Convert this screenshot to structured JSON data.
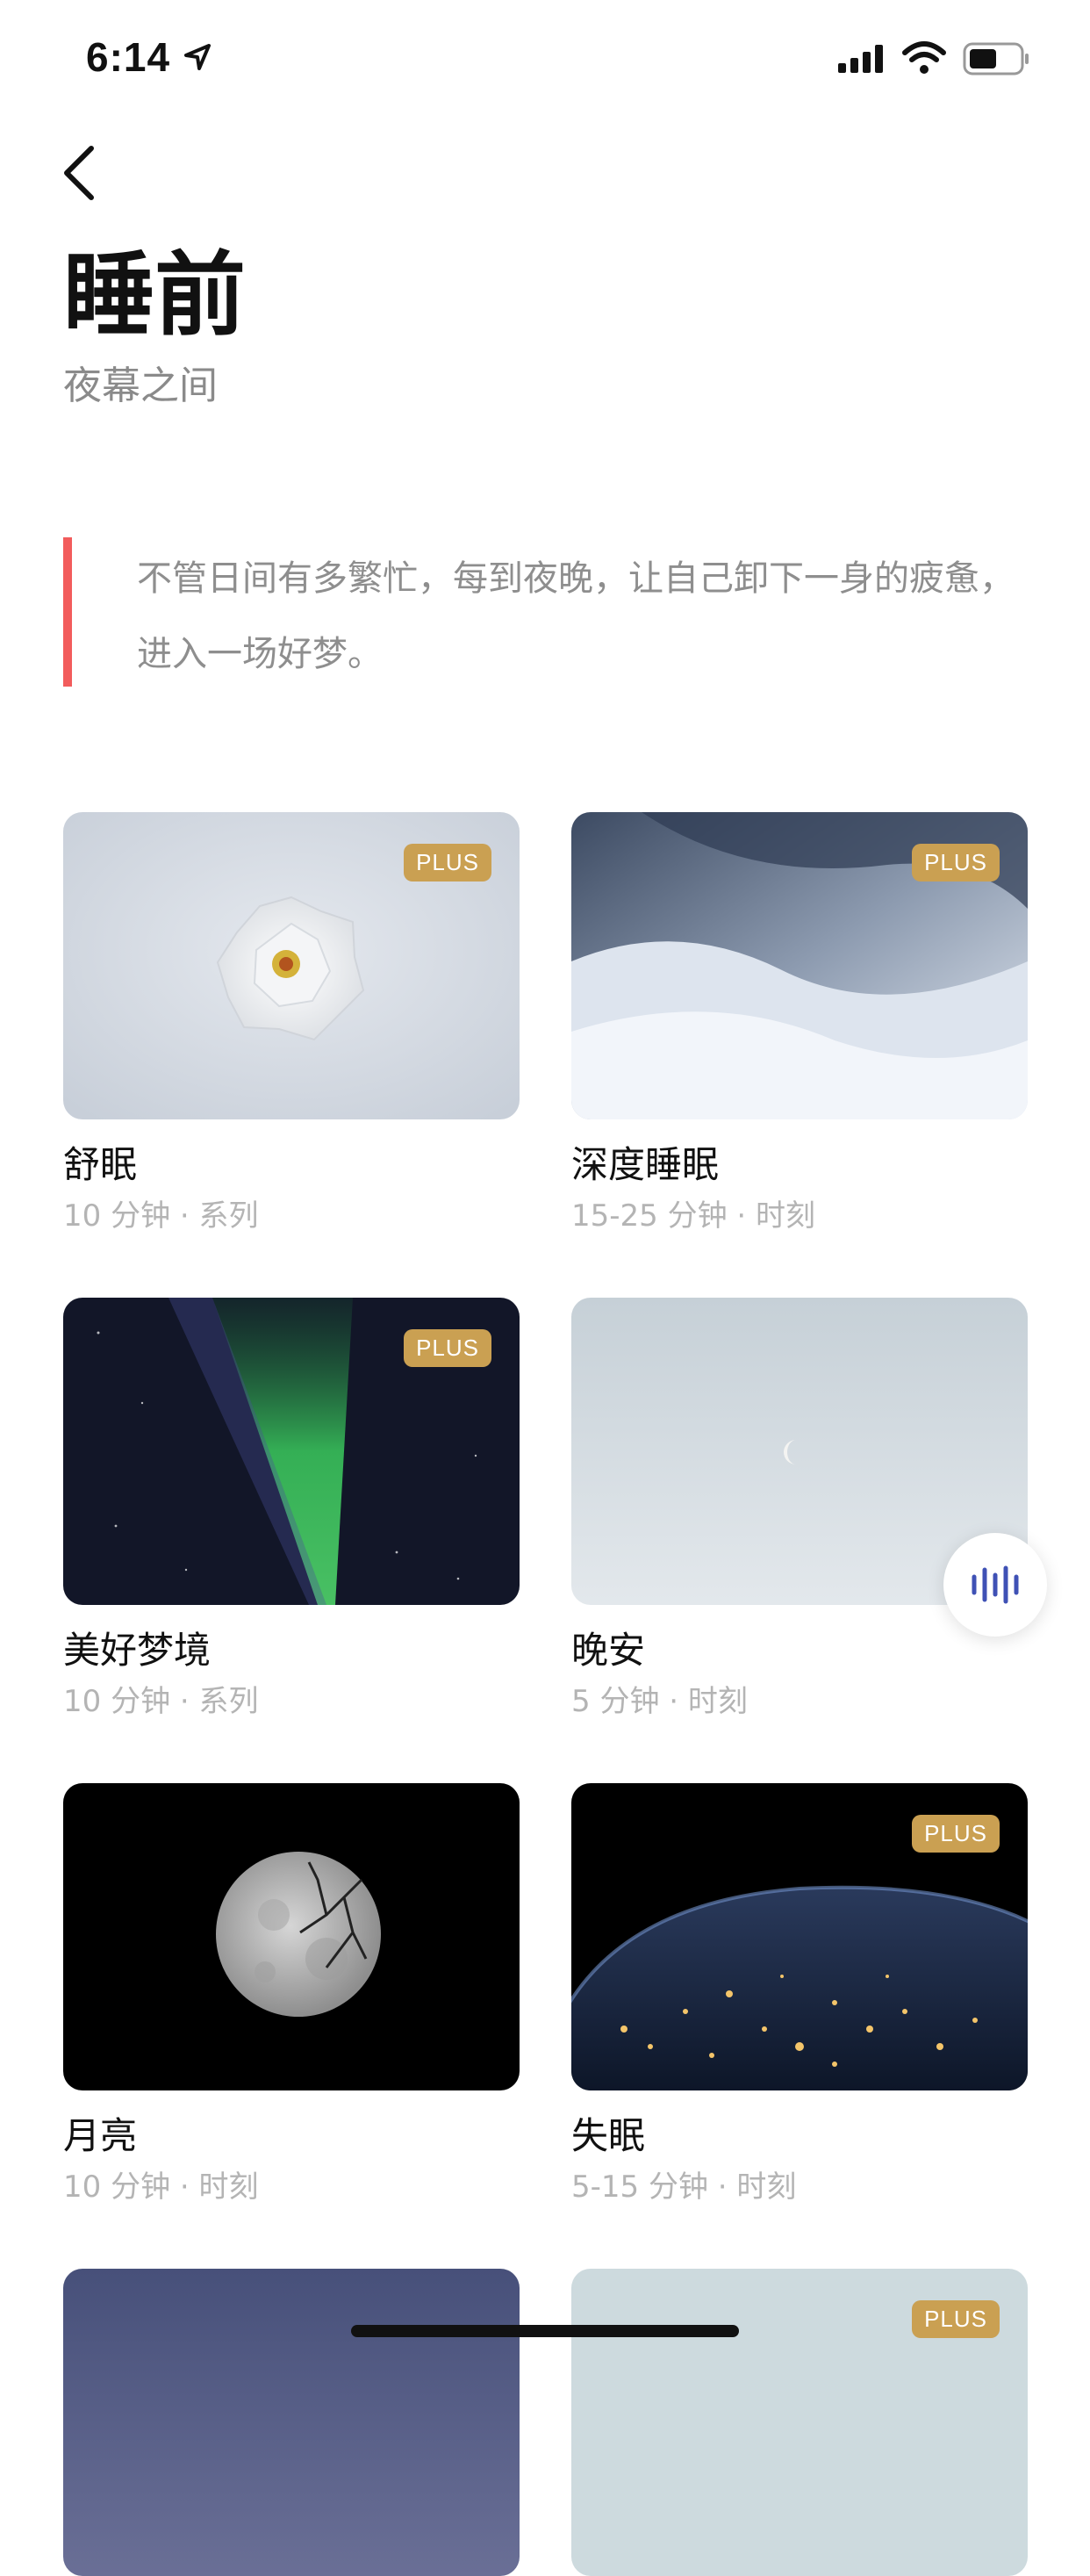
{
  "status_bar": {
    "time": "6:14"
  },
  "header": {
    "title": "睡前",
    "subtitle": "夜幕之间"
  },
  "quote": {
    "text": "不管日间有多繁忙，每到夜晚，让自己卸下一身的疲惫，进入一场好梦。"
  },
  "badge_label": "PLUS",
  "cards": [
    {
      "title": "舒眠",
      "meta": "10 分钟 · 系列",
      "plus": true,
      "image": "white-rose"
    },
    {
      "title": "深度睡眠",
      "meta": "15-25 分钟 · 时刻",
      "plus": true,
      "image": "snow-drifts"
    },
    {
      "title": "美好梦境",
      "meta": "10 分钟 · 系列",
      "plus": true,
      "image": "aurora"
    },
    {
      "title": "晚安",
      "meta": "5 分钟 · 时刻",
      "plus": false,
      "image": "moon-in-sky"
    },
    {
      "title": "月亮",
      "meta": "10 分钟 · 时刻",
      "plus": false,
      "image": "full-moon"
    },
    {
      "title": "失眠",
      "meta": "5-15 分钟 · 时刻",
      "plus": true,
      "image": "earth-at-night"
    },
    {
      "title": "",
      "meta": "",
      "plus": false,
      "image": "dusk-sky"
    },
    {
      "title": "",
      "meta": "",
      "plus": true,
      "image": "pale-sky"
    }
  ],
  "colors": {
    "accent_bar": "#f25c5c",
    "plus_badge": "#caa052",
    "audio_icon": "#3f51b5"
  },
  "icons": [
    "location-arrow-icon",
    "signal-icon",
    "wifi-icon",
    "battery-icon",
    "back-chevron-icon",
    "audio-wave-icon"
  ]
}
